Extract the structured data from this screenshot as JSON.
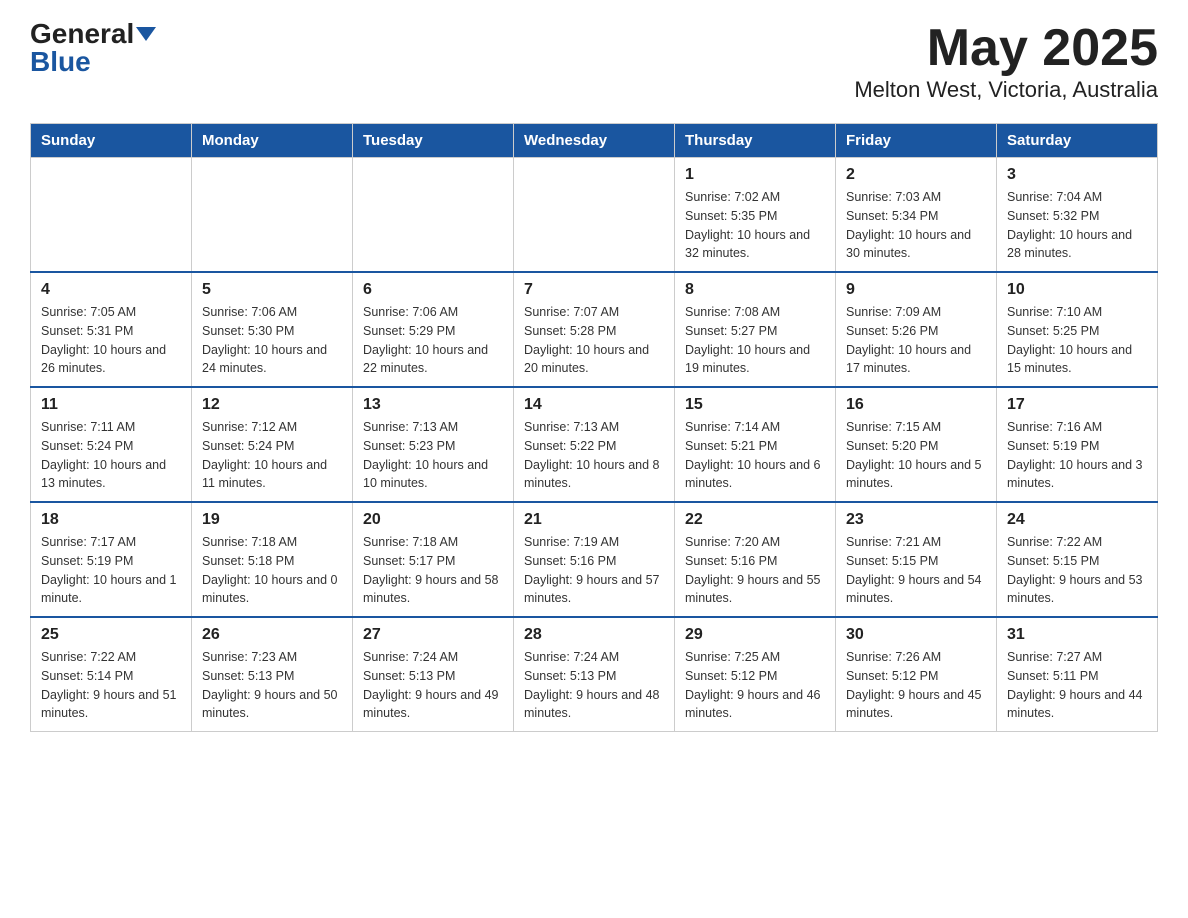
{
  "header": {
    "logo": {
      "general": "General",
      "blue": "Blue",
      "tagline": "GeneralBlue"
    },
    "title": "May 2025",
    "location": "Melton West, Victoria, Australia"
  },
  "weekdays": [
    "Sunday",
    "Monday",
    "Tuesday",
    "Wednesday",
    "Thursday",
    "Friday",
    "Saturday"
  ],
  "weeks": [
    [
      {
        "day": "",
        "info": ""
      },
      {
        "day": "",
        "info": ""
      },
      {
        "day": "",
        "info": ""
      },
      {
        "day": "",
        "info": ""
      },
      {
        "day": "1",
        "info": "Sunrise: 7:02 AM\nSunset: 5:35 PM\nDaylight: 10 hours and 32 minutes."
      },
      {
        "day": "2",
        "info": "Sunrise: 7:03 AM\nSunset: 5:34 PM\nDaylight: 10 hours and 30 minutes."
      },
      {
        "day": "3",
        "info": "Sunrise: 7:04 AM\nSunset: 5:32 PM\nDaylight: 10 hours and 28 minutes."
      }
    ],
    [
      {
        "day": "4",
        "info": "Sunrise: 7:05 AM\nSunset: 5:31 PM\nDaylight: 10 hours and 26 minutes."
      },
      {
        "day": "5",
        "info": "Sunrise: 7:06 AM\nSunset: 5:30 PM\nDaylight: 10 hours and 24 minutes."
      },
      {
        "day": "6",
        "info": "Sunrise: 7:06 AM\nSunset: 5:29 PM\nDaylight: 10 hours and 22 minutes."
      },
      {
        "day": "7",
        "info": "Sunrise: 7:07 AM\nSunset: 5:28 PM\nDaylight: 10 hours and 20 minutes."
      },
      {
        "day": "8",
        "info": "Sunrise: 7:08 AM\nSunset: 5:27 PM\nDaylight: 10 hours and 19 minutes."
      },
      {
        "day": "9",
        "info": "Sunrise: 7:09 AM\nSunset: 5:26 PM\nDaylight: 10 hours and 17 minutes."
      },
      {
        "day": "10",
        "info": "Sunrise: 7:10 AM\nSunset: 5:25 PM\nDaylight: 10 hours and 15 minutes."
      }
    ],
    [
      {
        "day": "11",
        "info": "Sunrise: 7:11 AM\nSunset: 5:24 PM\nDaylight: 10 hours and 13 minutes."
      },
      {
        "day": "12",
        "info": "Sunrise: 7:12 AM\nSunset: 5:24 PM\nDaylight: 10 hours and 11 minutes."
      },
      {
        "day": "13",
        "info": "Sunrise: 7:13 AM\nSunset: 5:23 PM\nDaylight: 10 hours and 10 minutes."
      },
      {
        "day": "14",
        "info": "Sunrise: 7:13 AM\nSunset: 5:22 PM\nDaylight: 10 hours and 8 minutes."
      },
      {
        "day": "15",
        "info": "Sunrise: 7:14 AM\nSunset: 5:21 PM\nDaylight: 10 hours and 6 minutes."
      },
      {
        "day": "16",
        "info": "Sunrise: 7:15 AM\nSunset: 5:20 PM\nDaylight: 10 hours and 5 minutes."
      },
      {
        "day": "17",
        "info": "Sunrise: 7:16 AM\nSunset: 5:19 PM\nDaylight: 10 hours and 3 minutes."
      }
    ],
    [
      {
        "day": "18",
        "info": "Sunrise: 7:17 AM\nSunset: 5:19 PM\nDaylight: 10 hours and 1 minute."
      },
      {
        "day": "19",
        "info": "Sunrise: 7:18 AM\nSunset: 5:18 PM\nDaylight: 10 hours and 0 minutes."
      },
      {
        "day": "20",
        "info": "Sunrise: 7:18 AM\nSunset: 5:17 PM\nDaylight: 9 hours and 58 minutes."
      },
      {
        "day": "21",
        "info": "Sunrise: 7:19 AM\nSunset: 5:16 PM\nDaylight: 9 hours and 57 minutes."
      },
      {
        "day": "22",
        "info": "Sunrise: 7:20 AM\nSunset: 5:16 PM\nDaylight: 9 hours and 55 minutes."
      },
      {
        "day": "23",
        "info": "Sunrise: 7:21 AM\nSunset: 5:15 PM\nDaylight: 9 hours and 54 minutes."
      },
      {
        "day": "24",
        "info": "Sunrise: 7:22 AM\nSunset: 5:15 PM\nDaylight: 9 hours and 53 minutes."
      }
    ],
    [
      {
        "day": "25",
        "info": "Sunrise: 7:22 AM\nSunset: 5:14 PM\nDaylight: 9 hours and 51 minutes."
      },
      {
        "day": "26",
        "info": "Sunrise: 7:23 AM\nSunset: 5:13 PM\nDaylight: 9 hours and 50 minutes."
      },
      {
        "day": "27",
        "info": "Sunrise: 7:24 AM\nSunset: 5:13 PM\nDaylight: 9 hours and 49 minutes."
      },
      {
        "day": "28",
        "info": "Sunrise: 7:24 AM\nSunset: 5:13 PM\nDaylight: 9 hours and 48 minutes."
      },
      {
        "day": "29",
        "info": "Sunrise: 7:25 AM\nSunset: 5:12 PM\nDaylight: 9 hours and 46 minutes."
      },
      {
        "day": "30",
        "info": "Sunrise: 7:26 AM\nSunset: 5:12 PM\nDaylight: 9 hours and 45 minutes."
      },
      {
        "day": "31",
        "info": "Sunrise: 7:27 AM\nSunset: 5:11 PM\nDaylight: 9 hours and 44 minutes."
      }
    ]
  ]
}
